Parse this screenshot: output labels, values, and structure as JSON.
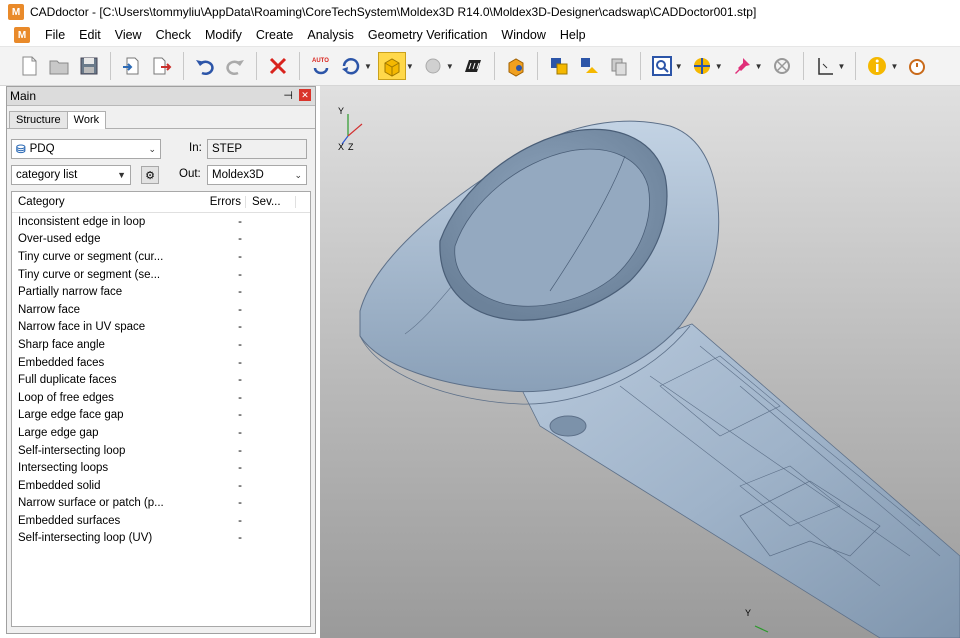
{
  "window": {
    "app_icon_letter": "M",
    "title": "CADdoctor - [C:\\Users\\tommyliu\\AppData\\Roaming\\CoreTechSystem\\Moldex3D R14.0\\Moldex3D-Designer\\cadswap\\CADDoctor001.stp]"
  },
  "menu": {
    "items": [
      "File",
      "Edit",
      "View",
      "Check",
      "Modify",
      "Create",
      "Analysis",
      "Geometry Verification",
      "Window",
      "Help"
    ]
  },
  "toolbar": {
    "icons": [
      "new-file-icon",
      "open-folder-icon",
      "save-icon",
      "import-icon",
      "export-icon",
      "undo-icon",
      "redo-icon",
      "delete-icon",
      "auto-heal-icon",
      "rotate-icon",
      "solid-cube-icon",
      "sphere-icon",
      "wireframe-icon",
      "shade-icon",
      "convert-icon",
      "transfer-icon",
      "stack-icon",
      "zoom-fit-icon",
      "measure-icon",
      "pin-icon",
      "target-icon",
      "axis-icon",
      "info-icon",
      "timer-icon"
    ],
    "auto_label": "AUTO"
  },
  "panel": {
    "title": "Main",
    "tabs": [
      "Structure",
      "Work"
    ],
    "active_tab": "Work",
    "mode_select": "PDQ",
    "category_select": "category list",
    "in_label": "In:",
    "in_value": "STEP",
    "out_label": "Out:",
    "out_value": "Moldex3D"
  },
  "table": {
    "headers": [
      "Category",
      "Errors",
      "Sev..."
    ],
    "rows": [
      {
        "category": "Inconsistent edge in loop",
        "errors": "-"
      },
      {
        "category": "Over-used edge",
        "errors": "-"
      },
      {
        "category": "Tiny curve or segment (cur...",
        "errors": "-"
      },
      {
        "category": "Tiny curve or segment (se...",
        "errors": "-"
      },
      {
        "category": "Partially narrow face",
        "errors": "-"
      },
      {
        "category": "Narrow face",
        "errors": "-"
      },
      {
        "category": "Narrow face in UV space",
        "errors": "-"
      },
      {
        "category": "Sharp face angle",
        "errors": "-"
      },
      {
        "category": "Embedded faces",
        "errors": "-"
      },
      {
        "category": "Full duplicate faces",
        "errors": "-"
      },
      {
        "category": "Loop of free edges",
        "errors": "-"
      },
      {
        "category": "Large edge face gap",
        "errors": "-"
      },
      {
        "category": "Large edge gap",
        "errors": "-"
      },
      {
        "category": "Self-intersecting loop",
        "errors": "-"
      },
      {
        "category": "Intersecting loops",
        "errors": "-"
      },
      {
        "category": "Embedded solid",
        "errors": "-"
      },
      {
        "category": "Narrow surface or patch (p...",
        "errors": "-"
      },
      {
        "category": "Embedded surfaces",
        "errors": "-"
      },
      {
        "category": "Self-intersecting loop (UV)",
        "errors": "-"
      }
    ]
  },
  "viewport": {
    "axis_labels": {
      "y": "Y",
      "x": "X",
      "z": "Z"
    },
    "bottom_axis_label": "Y"
  }
}
